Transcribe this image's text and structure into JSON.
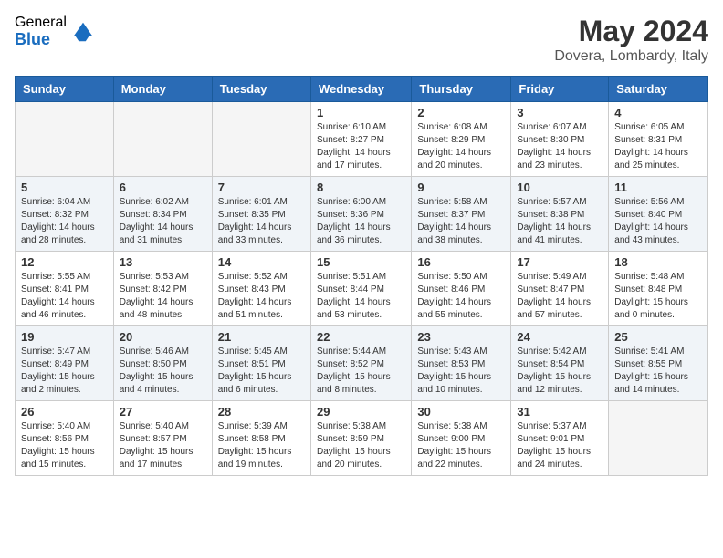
{
  "logo": {
    "general": "General",
    "blue": "Blue"
  },
  "title": {
    "month_year": "May 2024",
    "location": "Dovera, Lombardy, Italy"
  },
  "headers": [
    "Sunday",
    "Monday",
    "Tuesday",
    "Wednesday",
    "Thursday",
    "Friday",
    "Saturday"
  ],
  "weeks": [
    [
      {
        "day": "",
        "info": ""
      },
      {
        "day": "",
        "info": ""
      },
      {
        "day": "",
        "info": ""
      },
      {
        "day": "1",
        "info": "Sunrise: 6:10 AM\nSunset: 8:27 PM\nDaylight: 14 hours\nand 17 minutes."
      },
      {
        "day": "2",
        "info": "Sunrise: 6:08 AM\nSunset: 8:29 PM\nDaylight: 14 hours\nand 20 minutes."
      },
      {
        "day": "3",
        "info": "Sunrise: 6:07 AM\nSunset: 8:30 PM\nDaylight: 14 hours\nand 23 minutes."
      },
      {
        "day": "4",
        "info": "Sunrise: 6:05 AM\nSunset: 8:31 PM\nDaylight: 14 hours\nand 25 minutes."
      }
    ],
    [
      {
        "day": "5",
        "info": "Sunrise: 6:04 AM\nSunset: 8:32 PM\nDaylight: 14 hours\nand 28 minutes."
      },
      {
        "day": "6",
        "info": "Sunrise: 6:02 AM\nSunset: 8:34 PM\nDaylight: 14 hours\nand 31 minutes."
      },
      {
        "day": "7",
        "info": "Sunrise: 6:01 AM\nSunset: 8:35 PM\nDaylight: 14 hours\nand 33 minutes."
      },
      {
        "day": "8",
        "info": "Sunrise: 6:00 AM\nSunset: 8:36 PM\nDaylight: 14 hours\nand 36 minutes."
      },
      {
        "day": "9",
        "info": "Sunrise: 5:58 AM\nSunset: 8:37 PM\nDaylight: 14 hours\nand 38 minutes."
      },
      {
        "day": "10",
        "info": "Sunrise: 5:57 AM\nSunset: 8:38 PM\nDaylight: 14 hours\nand 41 minutes."
      },
      {
        "day": "11",
        "info": "Sunrise: 5:56 AM\nSunset: 8:40 PM\nDaylight: 14 hours\nand 43 minutes."
      }
    ],
    [
      {
        "day": "12",
        "info": "Sunrise: 5:55 AM\nSunset: 8:41 PM\nDaylight: 14 hours\nand 46 minutes."
      },
      {
        "day": "13",
        "info": "Sunrise: 5:53 AM\nSunset: 8:42 PM\nDaylight: 14 hours\nand 48 minutes."
      },
      {
        "day": "14",
        "info": "Sunrise: 5:52 AM\nSunset: 8:43 PM\nDaylight: 14 hours\nand 51 minutes."
      },
      {
        "day": "15",
        "info": "Sunrise: 5:51 AM\nSunset: 8:44 PM\nDaylight: 14 hours\nand 53 minutes."
      },
      {
        "day": "16",
        "info": "Sunrise: 5:50 AM\nSunset: 8:46 PM\nDaylight: 14 hours\nand 55 minutes."
      },
      {
        "day": "17",
        "info": "Sunrise: 5:49 AM\nSunset: 8:47 PM\nDaylight: 14 hours\nand 57 minutes."
      },
      {
        "day": "18",
        "info": "Sunrise: 5:48 AM\nSunset: 8:48 PM\nDaylight: 15 hours\nand 0 minutes."
      }
    ],
    [
      {
        "day": "19",
        "info": "Sunrise: 5:47 AM\nSunset: 8:49 PM\nDaylight: 15 hours\nand 2 minutes."
      },
      {
        "day": "20",
        "info": "Sunrise: 5:46 AM\nSunset: 8:50 PM\nDaylight: 15 hours\nand 4 minutes."
      },
      {
        "day": "21",
        "info": "Sunrise: 5:45 AM\nSunset: 8:51 PM\nDaylight: 15 hours\nand 6 minutes."
      },
      {
        "day": "22",
        "info": "Sunrise: 5:44 AM\nSunset: 8:52 PM\nDaylight: 15 hours\nand 8 minutes."
      },
      {
        "day": "23",
        "info": "Sunrise: 5:43 AM\nSunset: 8:53 PM\nDaylight: 15 hours\nand 10 minutes."
      },
      {
        "day": "24",
        "info": "Sunrise: 5:42 AM\nSunset: 8:54 PM\nDaylight: 15 hours\nand 12 minutes."
      },
      {
        "day": "25",
        "info": "Sunrise: 5:41 AM\nSunset: 8:55 PM\nDaylight: 15 hours\nand 14 minutes."
      }
    ],
    [
      {
        "day": "26",
        "info": "Sunrise: 5:40 AM\nSunset: 8:56 PM\nDaylight: 15 hours\nand 15 minutes."
      },
      {
        "day": "27",
        "info": "Sunrise: 5:40 AM\nSunset: 8:57 PM\nDaylight: 15 hours\nand 17 minutes."
      },
      {
        "day": "28",
        "info": "Sunrise: 5:39 AM\nSunset: 8:58 PM\nDaylight: 15 hours\nand 19 minutes."
      },
      {
        "day": "29",
        "info": "Sunrise: 5:38 AM\nSunset: 8:59 PM\nDaylight: 15 hours\nand 20 minutes."
      },
      {
        "day": "30",
        "info": "Sunrise: 5:38 AM\nSunset: 9:00 PM\nDaylight: 15 hours\nand 22 minutes."
      },
      {
        "day": "31",
        "info": "Sunrise: 5:37 AM\nSunset: 9:01 PM\nDaylight: 15 hours\nand 24 minutes."
      },
      {
        "day": "",
        "info": ""
      }
    ]
  ]
}
